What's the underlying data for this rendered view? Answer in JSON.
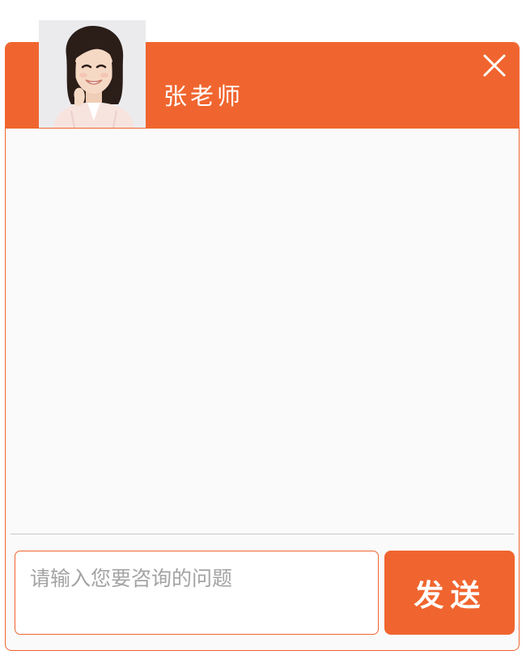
{
  "header": {
    "teacher_name": "张老师",
    "close_icon": "close-icon"
  },
  "avatar": {
    "icon": "teacher-avatar-photo"
  },
  "input": {
    "placeholder": "请输入您要咨询的问题",
    "value": ""
  },
  "send": {
    "label": "发送"
  },
  "colors": {
    "accent": "#f0652f",
    "background": "#fafafa",
    "placeholder": "#a3a3a3",
    "divider": "#c8c8c8"
  }
}
